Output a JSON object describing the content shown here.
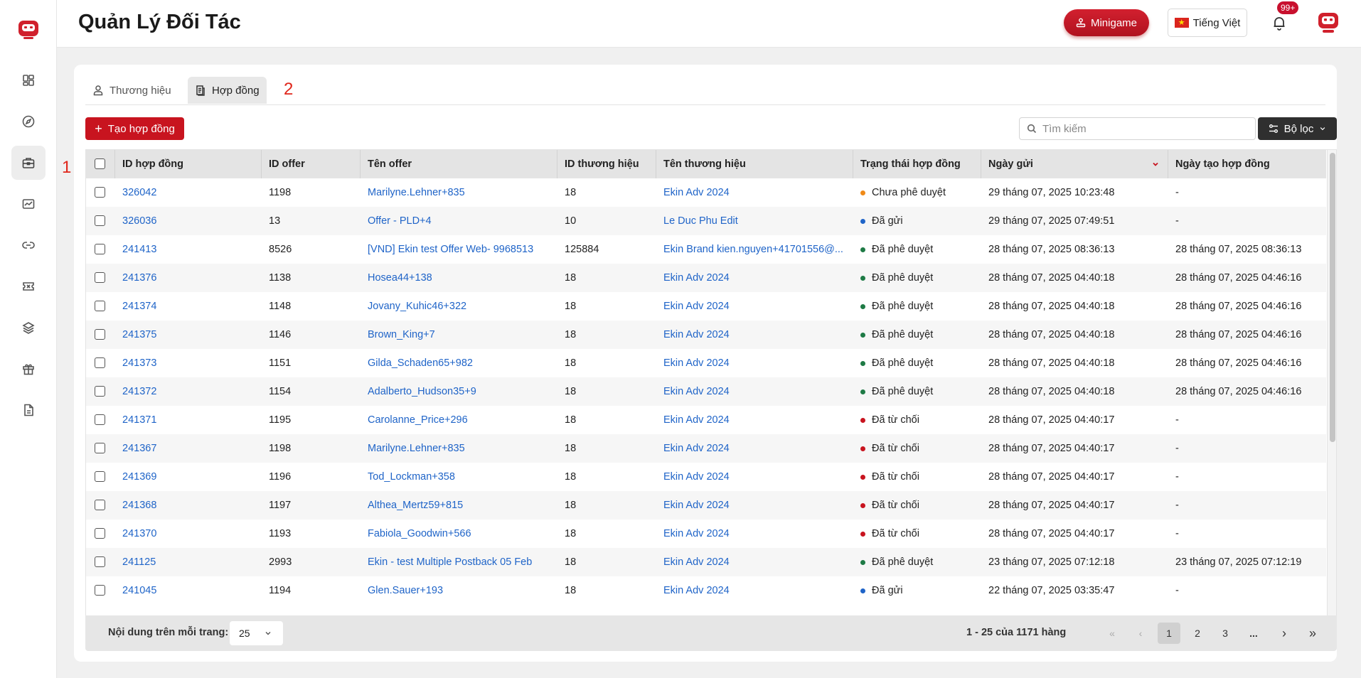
{
  "app": {
    "title": "Quản Lý Đối Tác",
    "minigame_label": "Minigame",
    "language_label": "Tiếng Việt",
    "notification_badge": "99+"
  },
  "sidebar": {
    "items": [
      {
        "icon": "dashboard-icon"
      },
      {
        "icon": "compass-icon"
      },
      {
        "icon": "briefcase-icon",
        "active": true
      },
      {
        "icon": "chart-icon"
      },
      {
        "icon": "link-icon"
      },
      {
        "icon": "ticket-icon"
      },
      {
        "icon": "layers-icon"
      },
      {
        "icon": "gift-icon"
      },
      {
        "icon": "document-icon"
      }
    ]
  },
  "annotations": {
    "one": "1",
    "two": "2"
  },
  "tabs": [
    {
      "label": "Thương hiệu",
      "icon": "user-icon"
    },
    {
      "label": "Hợp đồng",
      "icon": "contract-icon",
      "active": true
    }
  ],
  "toolbar": {
    "create_label": "Tạo hợp đồng",
    "search_placeholder": "Tìm kiếm",
    "filter_label": "Bộ lọc"
  },
  "table": {
    "columns": [
      "ID hợp đồng",
      "ID offer",
      "Tên offer",
      "ID thương hiệu",
      "Tên thương hiệu",
      "Trạng thái hợp đồng",
      "Ngày gửi",
      "Ngày tạo hợp đồng"
    ],
    "status_colors": {
      "Chưa phê duyệt": "#ef8a17",
      "Đã gửi": "#1f64c8",
      "Đã phê duyệt": "#1e7a45",
      "Đã từ chối": "#c8141f"
    },
    "rows": [
      {
        "id": "326042",
        "offer_id": "1198",
        "offer_name": "Marilyne.Lehner+835",
        "brand_id": "18",
        "brand_name": "Ekin Adv 2024",
        "status": "Chưa phê duyệt",
        "sent": "29 tháng 07, 2025 10:23:48",
        "created": "-"
      },
      {
        "id": "326036",
        "offer_id": "13",
        "offer_name": "Offer - PLD+4",
        "brand_id": "10",
        "brand_name": "Le Duc Phu Edit",
        "status": "Đã gửi",
        "sent": "29 tháng 07, 2025 07:49:51",
        "created": "-"
      },
      {
        "id": "241413",
        "offer_id": "8526",
        "offer_name": "[VND] Ekin test Offer Web- 9968513",
        "brand_id": "125884",
        "brand_name": "Ekin Brand kien.nguyen+41701556@...",
        "status": "Đã phê duyệt",
        "sent": "28 tháng 07, 2025 08:36:13",
        "created": "28 tháng 07, 2025 08:36:13"
      },
      {
        "id": "241376",
        "offer_id": "1138",
        "offer_name": "Hosea44+138",
        "brand_id": "18",
        "brand_name": "Ekin Adv 2024",
        "status": "Đã phê duyệt",
        "sent": "28 tháng 07, 2025 04:40:18",
        "created": "28 tháng 07, 2025 04:46:16"
      },
      {
        "id": "241374",
        "offer_id": "1148",
        "offer_name": "Jovany_Kuhic46+322",
        "brand_id": "18",
        "brand_name": "Ekin Adv 2024",
        "status": "Đã phê duyệt",
        "sent": "28 tháng 07, 2025 04:40:18",
        "created": "28 tháng 07, 2025 04:46:16"
      },
      {
        "id": "241375",
        "offer_id": "1146",
        "offer_name": "Brown_King+7",
        "brand_id": "18",
        "brand_name": "Ekin Adv 2024",
        "status": "Đã phê duyệt",
        "sent": "28 tháng 07, 2025 04:40:18",
        "created": "28 tháng 07, 2025 04:46:16"
      },
      {
        "id": "241373",
        "offer_id": "1151",
        "offer_name": "Gilda_Schaden65+982",
        "brand_id": "18",
        "brand_name": "Ekin Adv 2024",
        "status": "Đã phê duyệt",
        "sent": "28 tháng 07, 2025 04:40:18",
        "created": "28 tháng 07, 2025 04:46:16"
      },
      {
        "id": "241372",
        "offer_id": "1154",
        "offer_name": "Adalberto_Hudson35+9",
        "brand_id": "18",
        "brand_name": "Ekin Adv 2024",
        "status": "Đã phê duyệt",
        "sent": "28 tháng 07, 2025 04:40:18",
        "created": "28 tháng 07, 2025 04:46:16"
      },
      {
        "id": "241371",
        "offer_id": "1195",
        "offer_name": "Carolanne_Price+296",
        "brand_id": "18",
        "brand_name": "Ekin Adv 2024",
        "status": "Đã từ chối",
        "sent": "28 tháng 07, 2025 04:40:17",
        "created": "-"
      },
      {
        "id": "241367",
        "offer_id": "1198",
        "offer_name": "Marilyne.Lehner+835",
        "brand_id": "18",
        "brand_name": "Ekin Adv 2024",
        "status": "Đã từ chối",
        "sent": "28 tháng 07, 2025 04:40:17",
        "created": "-"
      },
      {
        "id": "241369",
        "offer_id": "1196",
        "offer_name": "Tod_Lockman+358",
        "brand_id": "18",
        "brand_name": "Ekin Adv 2024",
        "status": "Đã từ chối",
        "sent": "28 tháng 07, 2025 04:40:17",
        "created": "-"
      },
      {
        "id": "241368",
        "offer_id": "1197",
        "offer_name": "Althea_Mertz59+815",
        "brand_id": "18",
        "brand_name": "Ekin Adv 2024",
        "status": "Đã từ chối",
        "sent": "28 tháng 07, 2025 04:40:17",
        "created": "-"
      },
      {
        "id": "241370",
        "offer_id": "1193",
        "offer_name": "Fabiola_Goodwin+566",
        "brand_id": "18",
        "brand_name": "Ekin Adv 2024",
        "status": "Đã từ chối",
        "sent": "28 tháng 07, 2025 04:40:17",
        "created": "-"
      },
      {
        "id": "241125",
        "offer_id": "2993",
        "offer_name": "Ekin - test Multiple Postback 05 Feb",
        "brand_id": "18",
        "brand_name": "Ekin Adv 2024",
        "status": "Đã phê duyệt",
        "sent": "23 tháng 07, 2025 07:12:18",
        "created": "23 tháng 07, 2025 07:12:19"
      },
      {
        "id": "241045",
        "offer_id": "1194",
        "offer_name": "Glen.Sauer+193",
        "brand_id": "18",
        "brand_name": "Ekin Adv 2024",
        "status": "Đã gửi",
        "sent": "22 tháng 07, 2025 03:35:47",
        "created": "-"
      }
    ]
  },
  "pagination": {
    "rows_per_page_label": "Nội dung trên mỗi trang:",
    "rows_per_page_value": "25",
    "range_text": "1 - 25 của 1171 hàng",
    "pages": [
      "1",
      "2",
      "3",
      "..."
    ],
    "current_page": "1",
    "first_glyph": "«",
    "prev_glyph": "‹",
    "next_glyph": "›",
    "last_glyph": "»"
  }
}
